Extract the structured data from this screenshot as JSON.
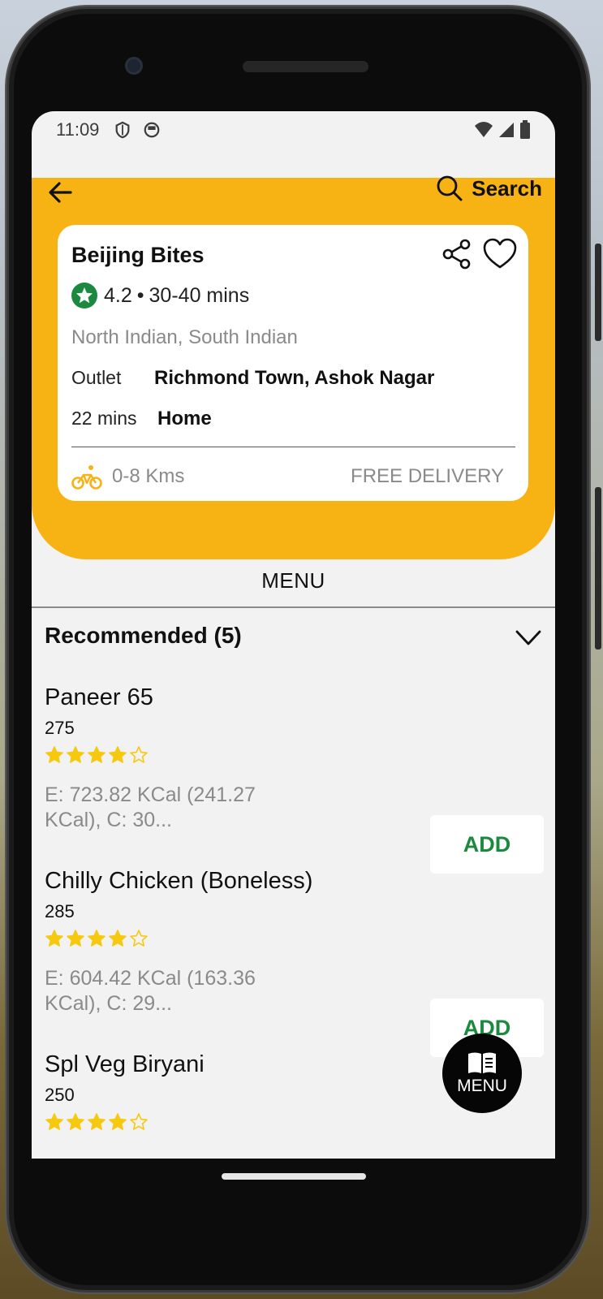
{
  "status_bar": {
    "time": "11:09"
  },
  "header": {
    "search_label": "Search"
  },
  "restaurant": {
    "name": "Beijing Bites",
    "rating": "4.2",
    "eta": "30-40 mins",
    "cuisines": "North Indian, South Indian",
    "outlet_label": "Outlet",
    "outlet_value": "Richmond Town, Ashok Nagar",
    "delivery_time": "22 mins",
    "delivery_to": "Home",
    "distance": "0-8 Kms",
    "delivery_fee": "FREE DELIVERY"
  },
  "menu_tab": "MENU",
  "section": {
    "title": "Recommended (5)"
  },
  "items": [
    {
      "name": "Paneer 65",
      "price": "275",
      "rating": 4,
      "desc": "E: 723.82 KCal (241.27 KCal), C: 30...",
      "add_label": "ADD"
    },
    {
      "name": "Chilly Chicken (Boneless)",
      "price": "285",
      "rating": 4,
      "desc": "E: 604.42 KCal (163.36 KCal), C: 29...",
      "add_label": "ADD"
    },
    {
      "name": "Spl Veg Biryani",
      "price": "250",
      "rating": 4
    }
  ],
  "fab_label": "MENU",
  "colors": {
    "accent": "#f7b314",
    "add_green": "#1b8a3e",
    "rating_green": "#1b8a3e",
    "star_yellow": "#f6c90e"
  }
}
